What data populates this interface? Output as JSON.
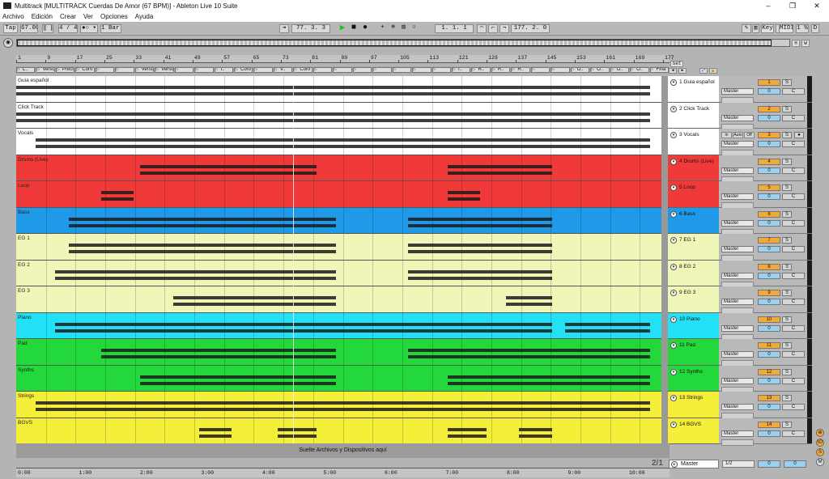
{
  "window": {
    "title": "Multitrack  [MULTITRACK Cuerdas De Amor (67 BPM)] - Ableton Live 10 Suite",
    "minimize": "–",
    "maximize": "❐",
    "close": "✕"
  },
  "menu": [
    "Archivo",
    "Edición",
    "Crear",
    "Ver",
    "Opciones",
    "Ayuda"
  ],
  "control_bar": {
    "tap": "Tap",
    "tempo": "67.00",
    "time_sig": "4 / 4",
    "metronome": "●○ ▾",
    "quantize": "1 Bar ▾",
    "position": "77.  3.  3",
    "loop_start": "1.  1.  1",
    "loop_length": "177.  2.  0",
    "key": "Key",
    "midi": "MIDI",
    "cpu": "1 %",
    "d_label": "D"
  },
  "overview_buttons": [
    "H",
    "W"
  ],
  "set_button": "Set",
  "ruler_bars": [
    "1",
    "9",
    "17",
    "25",
    "33",
    "41",
    "49",
    "57",
    "65",
    "73",
    "81",
    "89",
    "97",
    "105",
    "113",
    "121",
    "129",
    "137",
    "145",
    "153",
    "161",
    "169",
    "177"
  ],
  "locators": [
    "L..",
    "Verso 1",
    "Precoro",
    "Coro",
    "",
    "",
    "Verso 2",
    "Verso 3",
    "",
    "",
    "I..",
    "Coro",
    "",
    "V..",
    "Coro",
    "",
    "",
    "",
    "",
    "",
    "",
    "",
    "I..",
    "R..",
    "R..",
    "R..",
    "",
    "",
    "O..",
    "O..",
    "O..",
    "O..",
    "Fina"
  ],
  "tracks": [
    {
      "name": "Guia español",
      "header": "1 Guia español",
      "num": "1",
      "color": "#ffffff",
      "vol": "0",
      "output": "Master"
    },
    {
      "name": "Click Track",
      "header": "2 Click Track",
      "num": "2",
      "color": "#ffffff",
      "vol": "0",
      "output": "Master"
    },
    {
      "name": "Vocals",
      "header": "3 Vocals",
      "num": "3",
      "color": "#ffffff",
      "vol": "0",
      "output": "Master"
    },
    {
      "name": "Drums (Live)",
      "header": "4 Drums (Live)",
      "num": "4",
      "color": "#f03a3a",
      "vol": "0",
      "output": "Master"
    },
    {
      "name": "Loop",
      "header": "5 Loop",
      "num": "5",
      "color": "#f03a3a",
      "vol": "0",
      "output": "Master"
    },
    {
      "name": "Bass",
      "header": "6 Bass",
      "num": "6",
      "color": "#1e9ae8",
      "vol": "0",
      "output": "Master"
    },
    {
      "name": "EG 1",
      "header": "7 EG 1",
      "num": "7",
      "color": "#f0f5b8",
      "vol": "0",
      "output": "Master"
    },
    {
      "name": "EG 2",
      "header": "8 EG 2",
      "num": "8",
      "color": "#f0f5b8",
      "vol": "0",
      "output": "Master"
    },
    {
      "name": "EG 3",
      "header": "9 EG 3",
      "num": "9",
      "color": "#f0f5b8",
      "vol": "0",
      "output": "Master"
    },
    {
      "name": "Piano",
      "header": "10 Piano",
      "num": "10",
      "color": "#22e0f5",
      "vol": "0",
      "output": "Master"
    },
    {
      "name": "Pad",
      "header": "11 Pad",
      "num": "11",
      "color": "#22d83a",
      "vol": "0",
      "output": "Master"
    },
    {
      "name": "Synths",
      "header": "12 Synths",
      "num": "12",
      "color": "#22d83a",
      "vol": "0",
      "output": "Master"
    },
    {
      "name": "Strings",
      "header": "13 Strings",
      "num": "13",
      "color": "#f5ef3a",
      "vol": "0",
      "output": "Master"
    },
    {
      "name": "BGVS",
      "header": "14 BGVS",
      "num": "14",
      "color": "#f5ef3a",
      "vol": "0",
      "output": "Master"
    }
  ],
  "vocals_monitor": [
    "In",
    "Auto",
    "Off"
  ],
  "solo_label": "S",
  "cue_label": "C",
  "drop_area": "Suelte Archivos y Dispositivos aquí",
  "master": {
    "label": "Master",
    "routing": "1/2",
    "vol": "0",
    "vol2": "0"
  },
  "zoom_label": "2/1",
  "time_ruler": [
    "0:00",
    "1:00",
    "2:00",
    "3:00",
    "4:00",
    "5:00",
    "6:00",
    "7:00",
    "8:00",
    "9:00",
    "10:00"
  ],
  "colors": {
    "accent_orange": "#f4a83a",
    "accent_blue": "#9ad0f0",
    "play_green": "#25c025"
  }
}
